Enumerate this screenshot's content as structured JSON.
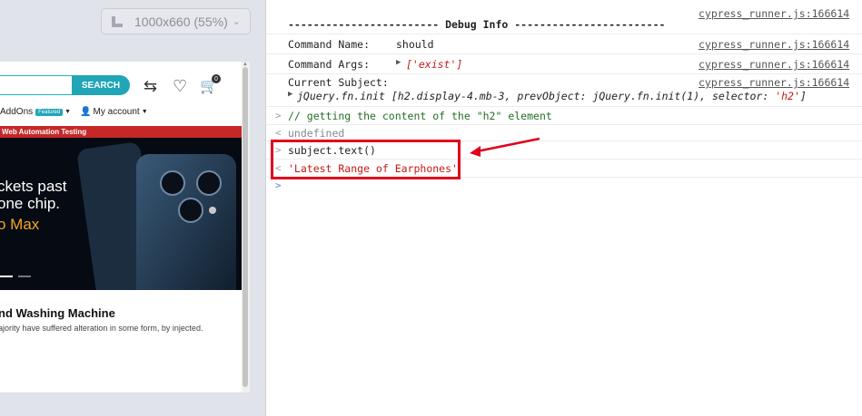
{
  "runner": {
    "viewport_label": "1000x660 (55%)",
    "search_button": "SEARCH",
    "cart_count": "0",
    "nav": {
      "addons": "AddOns",
      "featured": "Featured",
      "my_account": "My account"
    },
    "banner": "Web Automation Testing",
    "hero_lines": [
      "ckets past",
      "one chip.",
      "o Max"
    ],
    "product_title": "nd Washing Machine",
    "product_desc": "ajority have suffered alteration in some form, by injected."
  },
  "console": {
    "source_file": "cypress_runner.js:166614",
    "debug_header": "------------------------ Debug Info ------------------------",
    "command_name_label": "Command Name:",
    "command_name_value": "should",
    "command_args_label": "Command Args:",
    "command_args_value": "['exist']",
    "current_subject_label": "Current Subject:",
    "current_subject_prefix": "jQuery.fn.init [",
    "current_subject_sel": "h2.display-4.mb-3",
    "current_subject_mid": ", prevObject: jQuery.fn.init(1), selector: ",
    "current_subject_str": "'h2'",
    "current_subject_end": "]",
    "comment": "// getting the content of the \"h2\" element",
    "undefined": "undefined",
    "input_cmd": "subject.text()",
    "output_value": "'Latest Range of Earphones'"
  },
  "colors": {
    "highlight": "#e0001b",
    "accent": "#21a6b8"
  }
}
